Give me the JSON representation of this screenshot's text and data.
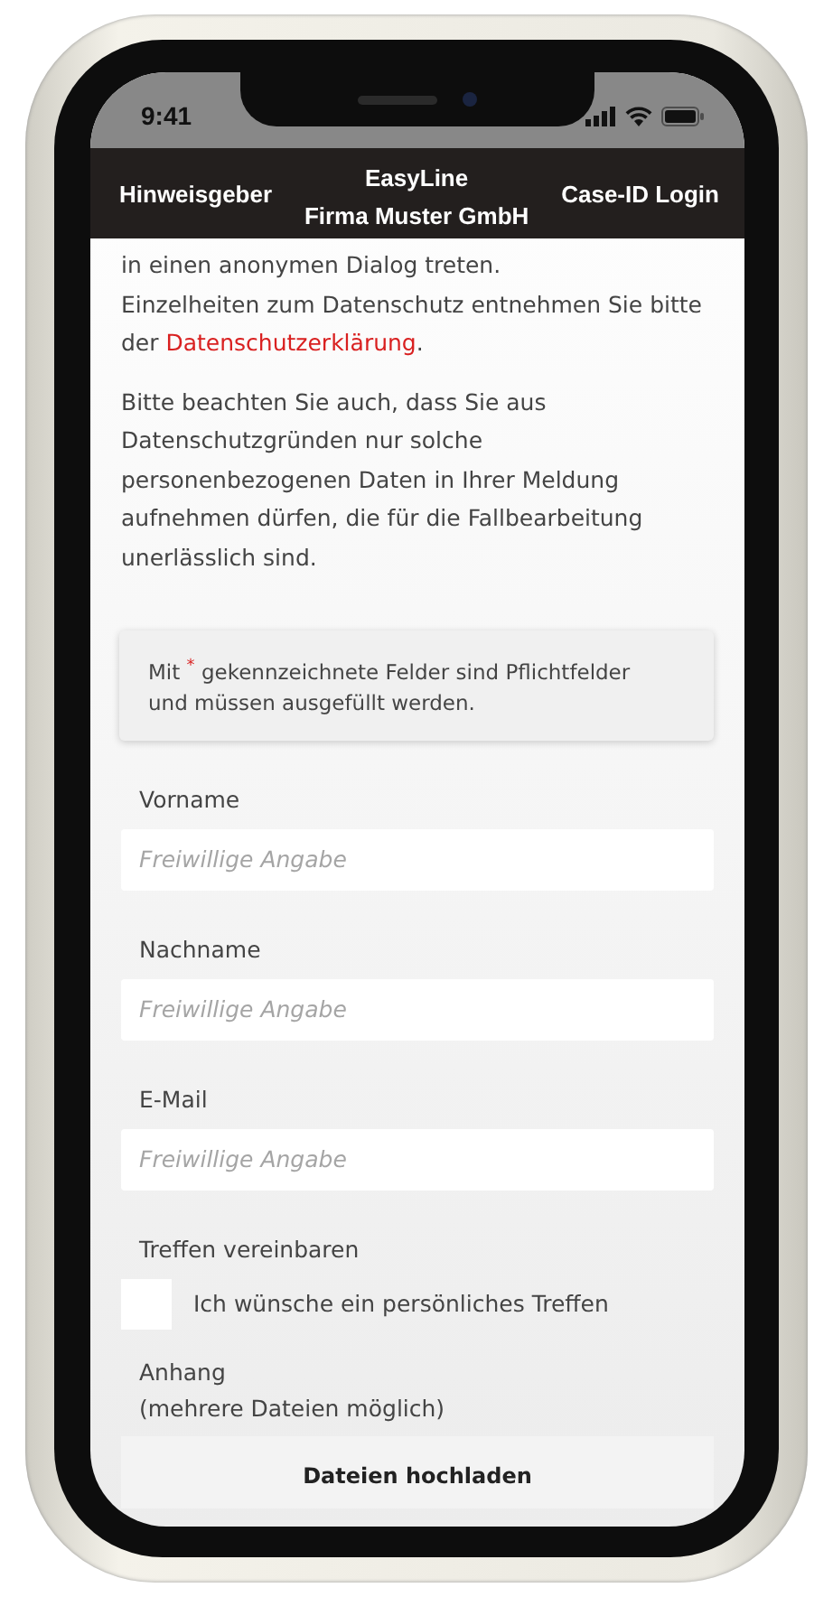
{
  "status_bar": {
    "time": "9:41"
  },
  "nav": {
    "left": "Hinweisgeber",
    "title": "EasyLine",
    "subtitle": "Firma Muster GmbH",
    "right": "Case-ID Login"
  },
  "intro": [
    {
      "text": "in einen anonymen Dialog treten.\nEinzelheiten zum Datenschutz entnehmen Sie bitte\nder ",
      "link": "Datenschutzerklärung",
      "after": "."
    },
    {
      "text": "Bitte beachten Sie auch, dass Sie aus\nDatenschutzgründen nur solche\npersonenbezogenen Daten in Ihrer Meldung\naufnehmen dürfen, die für die Fallbearbeitung\nunerlässlich sind."
    }
  ],
  "notice": "Mit $^{*}$ gekennzeichnete Felder sind Pflichtfelder\nund müssen ausgefüllt werden.",
  "fields": [
    {
      "kind": "text",
      "label": "Vorname",
      "placeholder": "Freiwillige Angabe"
    },
    {
      "kind": "text",
      "label": "Nachname",
      "placeholder": "Freiwillige Angabe"
    },
    {
      "kind": "text",
      "label": "E-Mail",
      "placeholder": "Freiwillige Angabe"
    },
    {
      "kind": "checkbox",
      "label": "Treffen vereinbaren",
      "option": "Ich wünsche ein persönliches Treffen",
      "checked": false
    },
    {
      "kind": "upload",
      "label": "Anhang\n(mehrere Dateien möglich)",
      "button": "Dateien hochladen"
    }
  ]
}
